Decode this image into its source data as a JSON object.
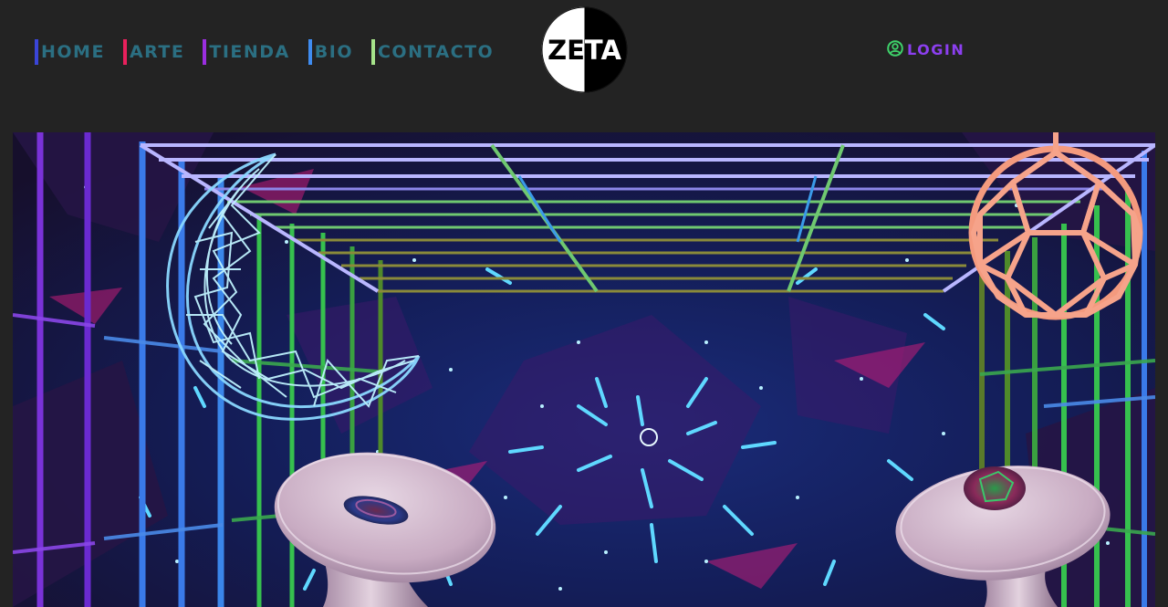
{
  "nav": {
    "items": [
      {
        "label": "HOME",
        "bar_color": "#3a45d8"
      },
      {
        "label": "ARTE",
        "bar_color": "#e8205c"
      },
      {
        "label": "TIENDA",
        "bar_color": "#9b2ee0"
      },
      {
        "label": "BIO",
        "bar_color": "#3f8cf0"
      },
      {
        "label": "CONTACTO",
        "bar_color": "#a6e38a"
      }
    ],
    "text_color": "#2b6f82"
  },
  "logo": {
    "text": "ZETA"
  },
  "login": {
    "label": "LOGIN",
    "icon": "user-circle-icon",
    "icon_color": "#3ed16a",
    "text_color": "#8c3ff0"
  },
  "hero": {
    "description_icons": [
      "wireframe-moon",
      "wireframe-sphere",
      "pedestal-gem-left",
      "pedestal-gem-right"
    ]
  },
  "theme": {
    "background": "#232323"
  }
}
